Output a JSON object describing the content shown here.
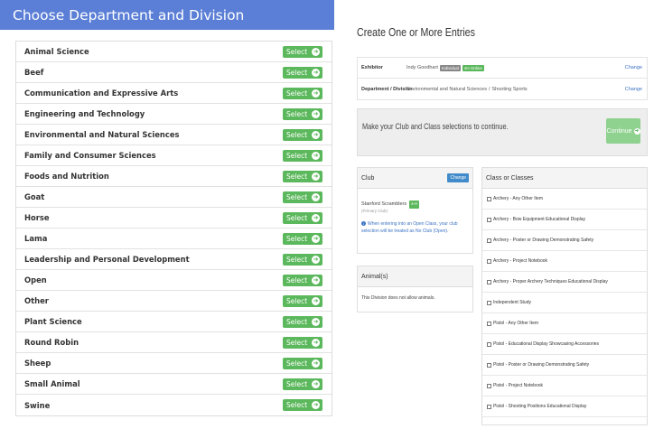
{
  "left": {
    "title": "Choose Department and Division",
    "select_label": "Select",
    "departments": [
      "Animal Science",
      "Beef",
      "Communication and Expressive Arts",
      "Engineering and Technology",
      "Environmental and Natural Sciences",
      "Family and Consumer Sciences",
      "Foods and Nutrition",
      "Goat",
      "Horse",
      "Lama",
      "Leadership and Personal Development",
      "Open",
      "Other",
      "Plant Science",
      "Round Robin",
      "Sheep",
      "Small Animal",
      "Swine"
    ]
  },
  "right": {
    "title": "Create One or More Entries",
    "exhibitor": {
      "label": "Exhibitor",
      "name": "Indy Goodhart",
      "badge1": "Individual",
      "badge2": "4H Online",
      "change": "Change"
    },
    "department": {
      "label": "Department / Division",
      "value": "Environmental and Natural Sciences",
      "separator": "/",
      "division": "Shooting Sports",
      "change": "Change"
    },
    "notice": {
      "text": "Make your Club and Class selections to continue.",
      "continue_label": "Continue"
    },
    "club": {
      "title": "Club",
      "change": "Change",
      "name": "Stanford Scramblers",
      "badge": "4-H",
      "sub": "(Primary Club)",
      "note": "When entering into an Open Class, your club selection will be treated as No Club (Open)."
    },
    "animals": {
      "title": "Animal(s)",
      "text": "This Division does not allow animals."
    },
    "classes": {
      "title": "Class or Classes",
      "items": [
        "Archery - Any Other Item",
        "Archery - Bow Equipment Educational Display",
        "Archery - Poster or Drawing Demonstrating Safety",
        "Archery - Project Notebook",
        "Archery - Proper Archery Techniques Educational Display",
        "Independent Study",
        "Pistol - Any Other Item",
        "Pistol - Educational Display Showcasing Accessories",
        "Pistol - Poster or Drawing Demonstrating Safety",
        "Pistol - Project Notebook",
        "Pistol - Shooting Positions Educational Display"
      ]
    }
  },
  "colors": {
    "header_blue": "#5b7fd6",
    "select_green": "#5cb85c",
    "continue_green": "#8fd18f",
    "link_blue": "#3b73c4"
  }
}
